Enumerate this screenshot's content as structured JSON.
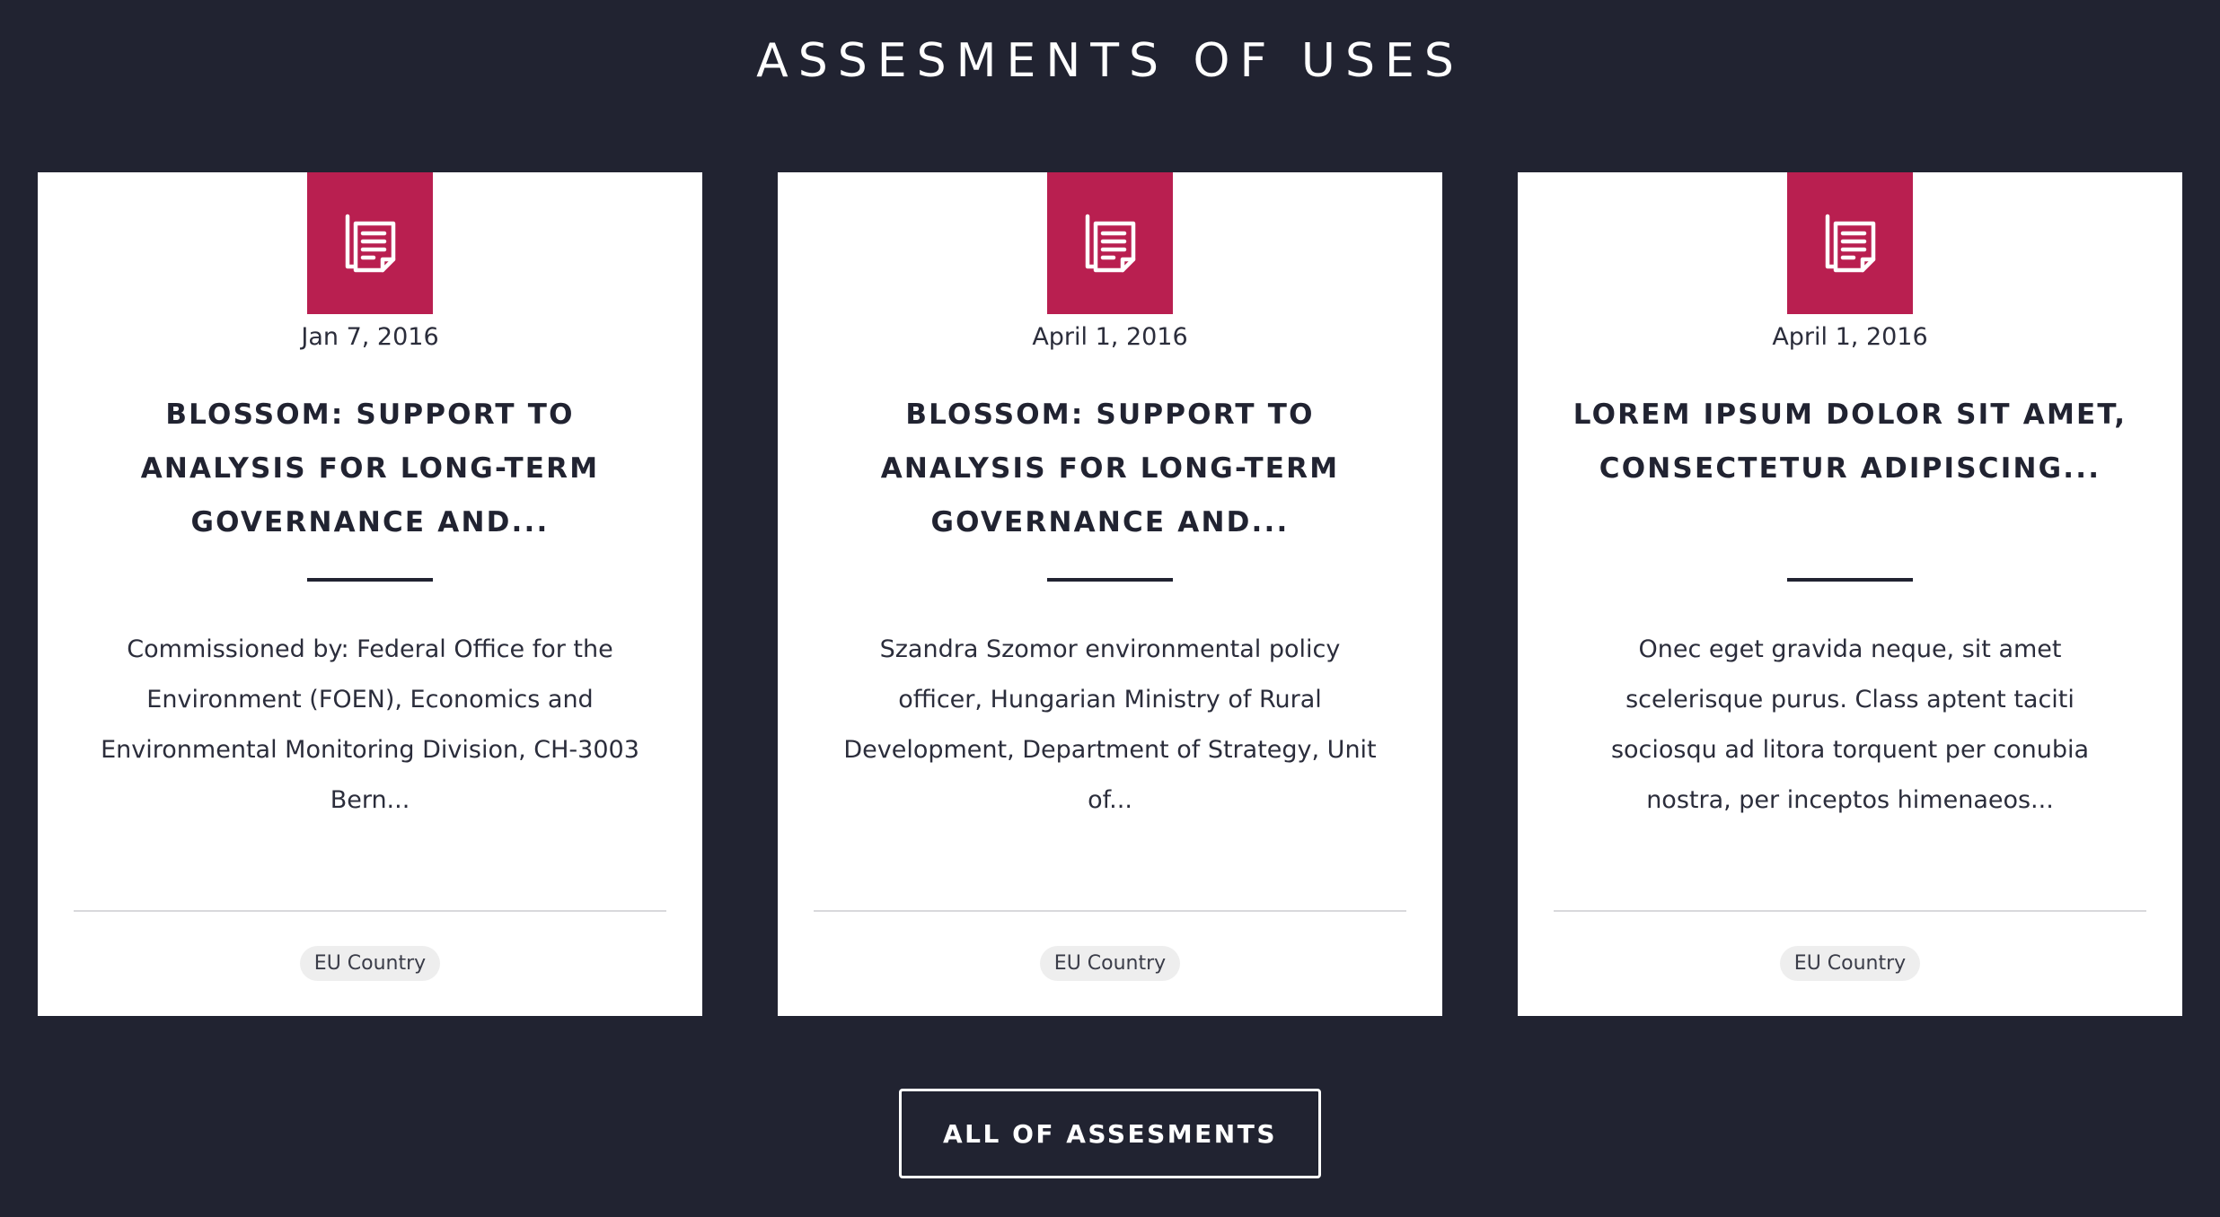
{
  "section": {
    "title": "ASSESMENTS OF USES"
  },
  "colors": {
    "background": "#212331",
    "accent": "#b91f50",
    "card": "#ffffff"
  },
  "cards": [
    {
      "icon": "document-icon",
      "date": "Jan 7, 2016",
      "title": "BLOSSOM: SUPPORT TO ANALYSIS FOR LONG-TERM GOVERNANCE AND...",
      "excerpt": "Commissioned by: Federal Office for the Environment (FOEN), Economics and Environmental Monitoring Division, CH-3003 Bern...",
      "tag": "EU Country"
    },
    {
      "icon": "document-icon",
      "date": "April 1, 2016",
      "title": "BLOSSOM: SUPPORT TO ANALYSIS FOR LONG-TERM GOVERNANCE AND...",
      "excerpt": "Szandra Szomor environmental policy officer, Hungarian Ministry of Rural Development, Department of Strategy, Unit of...",
      "tag": "EU Country"
    },
    {
      "icon": "document-icon",
      "date": "April 1, 2016",
      "title": "LOREM IPSUM DOLOR SIT AMET, CONSECTETUR ADIPISCING...",
      "excerpt": "Onec eget gravida neque, sit amet scelerisque purus. Class aptent taciti sociosqu ad litora torquent per conubia nostra, per inceptos himenaeos...",
      "tag": "EU Country"
    }
  ],
  "button": {
    "label": "ALL OF ASSESMENTS"
  }
}
